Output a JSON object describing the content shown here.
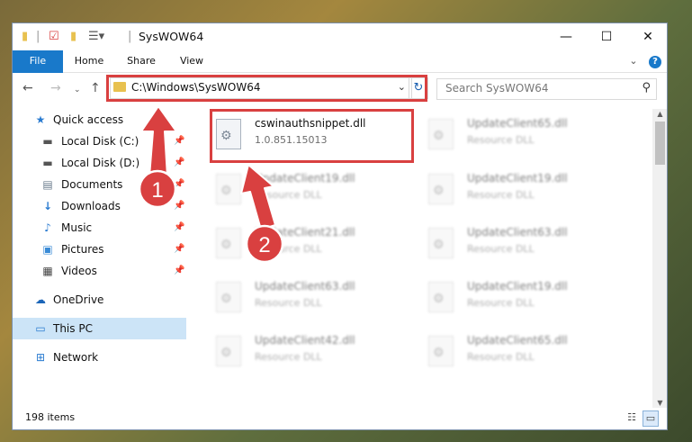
{
  "window": {
    "title": "SysWOW64",
    "controls": {
      "minimize": "—",
      "maximize": "☐",
      "close": "✕"
    }
  },
  "ribbon": {
    "tabs": [
      "File",
      "Home",
      "Share",
      "View"
    ],
    "expand_icon": "chevron-down-icon",
    "help_icon": "help-icon"
  },
  "address": {
    "path": "C:\\Windows\\SysWOW64",
    "search_placeholder": "Search SysWOW64"
  },
  "sidebar": {
    "items": [
      {
        "label": "Quick access",
        "icon": "star-icon",
        "pinned": false
      },
      {
        "label": "Local Disk (C:)",
        "icon": "drive-icon",
        "pinned": true
      },
      {
        "label": "Local Disk (D:)",
        "icon": "drive-icon",
        "pinned": true
      },
      {
        "label": "Documents",
        "icon": "documents-icon",
        "pinned": true
      },
      {
        "label": "Downloads",
        "icon": "downloads-icon",
        "pinned": true
      },
      {
        "label": "Music",
        "icon": "music-icon",
        "pinned": true
      },
      {
        "label": "Pictures",
        "icon": "pictures-icon",
        "pinned": true
      },
      {
        "label": "Videos",
        "icon": "videos-icon",
        "pinned": true
      },
      {
        "label": "OneDrive",
        "icon": "cloud-icon",
        "pinned": false
      },
      {
        "label": "This PC",
        "icon": "computer-icon",
        "pinned": false,
        "selected": true
      },
      {
        "label": "Network",
        "icon": "network-icon",
        "pinned": false
      }
    ]
  },
  "files": {
    "highlighted": {
      "name": "cswinauthsnippet.dll",
      "detail": "1.0.851.15013"
    },
    "blurred": [
      {
        "name": "UpdateClient65.dll",
        "detail": "Resource DLL"
      },
      {
        "name": "UpdateClient19.dll",
        "detail": "Resource DLL"
      },
      {
        "name": "UpdateClient19.dll",
        "detail": "Resource DLL"
      },
      {
        "name": "UpdateClient21.dll",
        "detail": "Resource DLL"
      },
      {
        "name": "UpdateClient63.dll",
        "detail": "Resource DLL"
      },
      {
        "name": "UpdateClient63.dll",
        "detail": "Resource DLL"
      },
      {
        "name": "UpdateClient19.dll",
        "detail": "Resource DLL"
      },
      {
        "name": "UpdateClient42.dll",
        "detail": "Resource DLL"
      },
      {
        "name": "UpdateClient65.dll",
        "detail": "Resource DLL"
      }
    ]
  },
  "status": {
    "item_count": "198 items"
  },
  "annotations": {
    "step1": "1",
    "step2": "2",
    "color": "#d94040"
  }
}
